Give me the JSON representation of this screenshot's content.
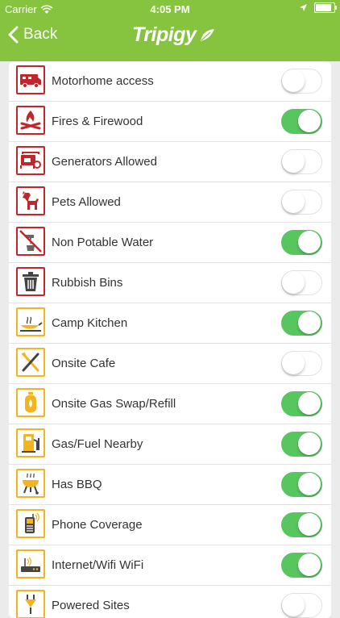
{
  "status": {
    "carrier": "Carrier",
    "time": "4:05 PM"
  },
  "nav": {
    "back_label": "Back",
    "logo_text": "Tripigy"
  },
  "colors": {
    "brand_green": "#86c440",
    "switch_on": "#57c65e",
    "icon_red": "#c0272d",
    "icon_yellow": "#f3b41e"
  },
  "amenities": [
    {
      "label": "Motorhome access",
      "icon": "motorhome-icon",
      "on": false
    },
    {
      "label": "Fires & Firewood",
      "icon": "campfire-icon",
      "on": true
    },
    {
      "label": "Generators Allowed",
      "icon": "generator-icon",
      "on": false
    },
    {
      "label": "Pets Allowed",
      "icon": "dog-icon",
      "on": false
    },
    {
      "label": "Non Potable Water",
      "icon": "non-potable-water-icon",
      "on": true
    },
    {
      "label": "Rubbish Bins",
      "icon": "rubbish-bin-icon",
      "on": false
    },
    {
      "label": "Camp Kitchen",
      "icon": "camp-kitchen-icon",
      "on": true
    },
    {
      "label": "Onsite Cafe",
      "icon": "cutlery-icon",
      "on": false
    },
    {
      "label": "Onsite Gas Swap/Refill",
      "icon": "gas-bottle-icon",
      "on": true
    },
    {
      "label": "Gas/Fuel Nearby",
      "icon": "fuel-pump-icon",
      "on": true
    },
    {
      "label": "Has BBQ",
      "icon": "bbq-icon",
      "on": true
    },
    {
      "label": "Phone Coverage",
      "icon": "phone-icon",
      "on": true
    },
    {
      "label": "Internet/Wifi WiFi",
      "icon": "router-icon",
      "on": true
    },
    {
      "label": "Powered Sites",
      "icon": "power-plug-icon",
      "on": false
    }
  ]
}
